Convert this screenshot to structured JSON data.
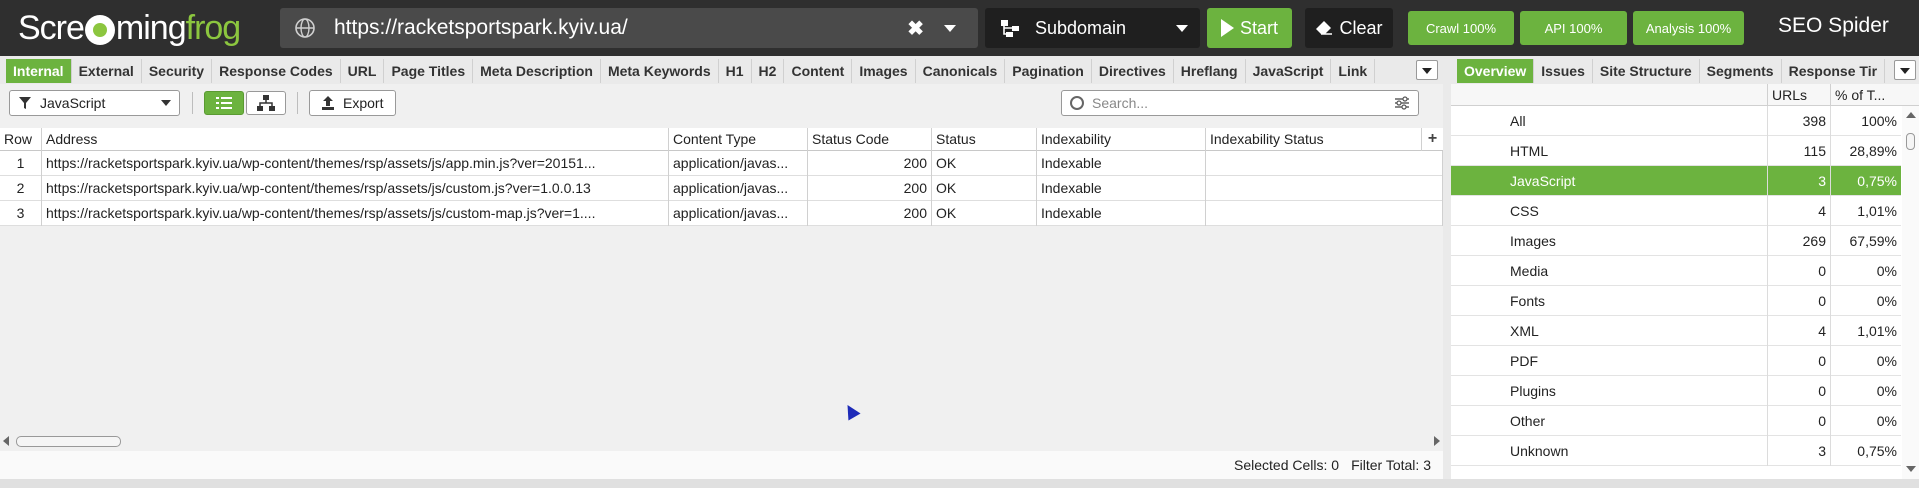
{
  "app": {
    "logo_part1": "Scre",
    "logo_part2": "ming",
    "logo_part3": "frog",
    "product": "SEO Spider"
  },
  "toolbar": {
    "url": "https://racketsportspark.kyiv.ua/",
    "mode": "Subdomain",
    "start_label": "Start",
    "clear_label": "Clear",
    "crawl_label": "Crawl 100%",
    "api_label": "API 100%",
    "analysis_label": "Analysis 100%"
  },
  "left_tabs": [
    "Internal",
    "External",
    "Security",
    "Response Codes",
    "URL",
    "Page Titles",
    "Meta Description",
    "Meta Keywords",
    "H1",
    "H2",
    "Content",
    "Images",
    "Canonicals",
    "Pagination",
    "Directives",
    "Hreflang",
    "JavaScript",
    "Link"
  ],
  "right_tabs": [
    "Overview",
    "Issues",
    "Site Structure",
    "Segments",
    "Response Tir"
  ],
  "filter": {
    "selected": "JavaScript",
    "export_label": "Export",
    "search_placeholder": "Search..."
  },
  "table": {
    "columns": [
      "Row",
      "Address",
      "Content Type",
      "Status Code",
      "Status",
      "Indexability",
      "Indexability Status"
    ],
    "rows": [
      {
        "row": "1",
        "address": "https://racketsportspark.kyiv.ua/wp-content/themes/rsp/assets/js/app.min.js?ver=20151...",
        "content_type": "application/javas...",
        "status_code": "200",
        "status": "OK",
        "indexability": "Indexable",
        "indexability_status": ""
      },
      {
        "row": "2",
        "address": "https://racketsportspark.kyiv.ua/wp-content/themes/rsp/assets/js/custom.js?ver=1.0.0.13",
        "content_type": "application/javas...",
        "status_code": "200",
        "status": "OK",
        "indexability": "Indexable",
        "indexability_status": ""
      },
      {
        "row": "3",
        "address": "https://racketsportspark.kyiv.ua/wp-content/themes/rsp/assets/js/custom-map.js?ver=1....",
        "content_type": "application/javas...",
        "status_code": "200",
        "status": "OK",
        "indexability": "Indexable",
        "indexability_status": ""
      }
    ]
  },
  "status": {
    "selected_cells_label": "Selected Cells:",
    "selected_cells": "0",
    "filter_total_label": "Filter Total:",
    "filter_total": "3"
  },
  "overview": {
    "col_urls": "URLs",
    "col_pct": "% of T...",
    "rows": [
      {
        "name": "All",
        "urls": "398",
        "pct": "100%"
      },
      {
        "name": "HTML",
        "urls": "115",
        "pct": "28,89%"
      },
      {
        "name": "JavaScript",
        "urls": "3",
        "pct": "0,75%"
      },
      {
        "name": "CSS",
        "urls": "4",
        "pct": "1,01%"
      },
      {
        "name": "Images",
        "urls": "269",
        "pct": "67,59%"
      },
      {
        "name": "Media",
        "urls": "0",
        "pct": "0%"
      },
      {
        "name": "Fonts",
        "urls": "0",
        "pct": "0%"
      },
      {
        "name": "XML",
        "urls": "4",
        "pct": "1,01%"
      },
      {
        "name": "PDF",
        "urls": "0",
        "pct": "0%"
      },
      {
        "name": "Plugins",
        "urls": "0",
        "pct": "0%"
      },
      {
        "name": "Other",
        "urls": "0",
        "pct": "0%"
      },
      {
        "name": "Unknown",
        "urls": "3",
        "pct": "0,75%"
      }
    ]
  },
  "icons": [
    "globe-icon",
    "clear-x-icon",
    "chevron-down-icon",
    "sitemap-icon",
    "play-icon",
    "eraser-icon",
    "filter-icon",
    "list-view-icon",
    "tree-view-icon",
    "export-icon",
    "search-icon",
    "search-options-icon",
    "add-column-icon"
  ],
  "colors": {
    "accent": "#6cb33f",
    "topbar": "#2f2f2f",
    "dark_button": "#1f1f1f"
  }
}
